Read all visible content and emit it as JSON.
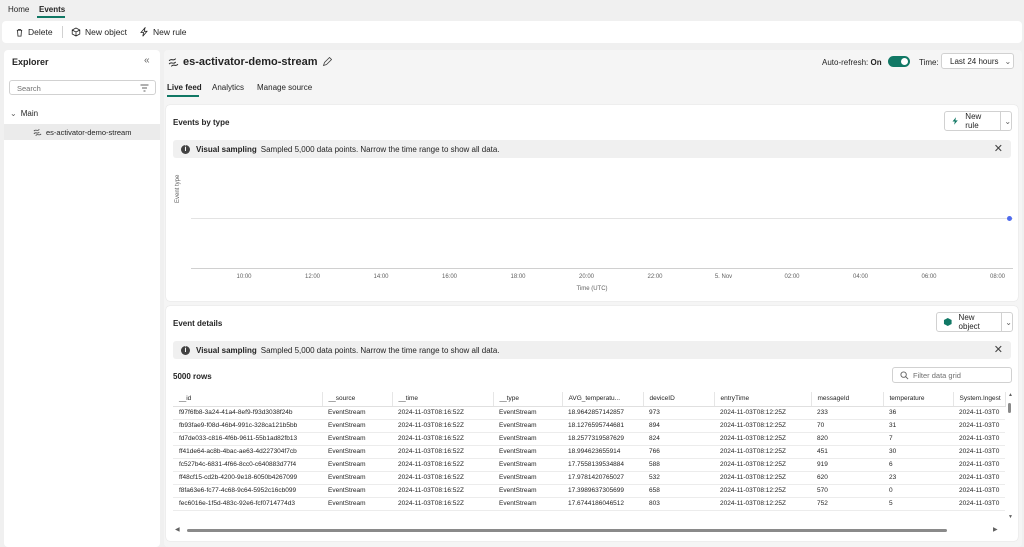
{
  "topnav": {
    "home": "Home",
    "events": "Events"
  },
  "toolbar": {
    "delete": "Delete",
    "new_object": "New object",
    "new_rule": "New rule"
  },
  "explorer": {
    "title": "Explorer",
    "search_placeholder": "Search",
    "group": "Main",
    "item": "es-activator-demo-stream"
  },
  "header": {
    "title": "es-activator-demo-stream",
    "auto_refresh_label": "Auto-refresh:",
    "auto_refresh_value": "On",
    "time_label": "Time:",
    "time_value": "Last 24 hours"
  },
  "tabs": [
    {
      "label": "Live feed"
    },
    {
      "label": "Analytics"
    },
    {
      "label": "Manage source"
    }
  ],
  "events_by_type": {
    "title": "Events by type",
    "new_rule": "New rule",
    "banner_bold": "Visual sampling",
    "banner_text": "Sampled 5,000 data points. Narrow the time range to show all data."
  },
  "chart_data": {
    "type": "scatter",
    "ylabel": "Event type",
    "xlabel": "Time (UTC)",
    "x_ticks": [
      "10:00",
      "12:00",
      "14:00",
      "16:00",
      "18:00",
      "20:00",
      "22:00",
      "5. Nov",
      "02:00",
      "04:00",
      "06:00",
      "08:00"
    ],
    "points": [
      {
        "x": "08:12"
      }
    ]
  },
  "event_details": {
    "title": "Event details",
    "new_object": "New object",
    "banner_bold": "Visual sampling",
    "banner_text": "Sampled 5,000 data points. Narrow the time range to show all data.",
    "row_count": "5000 rows",
    "filter_placeholder": "Filter data grid",
    "columns": [
      "__id",
      "__source",
      "__time",
      "__type",
      "AVG_temperatu...",
      "deviceID",
      "entryTime",
      "messageId",
      "temperature",
      "System.Ingest"
    ],
    "rows": [
      [
        "f97f6fb8-3a24-41a4-8ef9-f93d3038f24b",
        "EventStream",
        "2024-11-03T08:16:52Z",
        "EventStream",
        "18.9642857142857",
        "973",
        "2024-11-03T08:12:25Z",
        "233",
        "36",
        "2024-11-03T0"
      ],
      [
        "fb93fae9-f08d-46b4-991c-328ca121b5bb",
        "EventStream",
        "2024-11-03T08:16:52Z",
        "EventStream",
        "18.1276595744681",
        "894",
        "2024-11-03T08:12:25Z",
        "70",
        "31",
        "2024-11-03T0"
      ],
      [
        "fd7de033-c816-4f6b-9611-55b1ad82fb13",
        "EventStream",
        "2024-11-03T08:16:52Z",
        "EventStream",
        "18.2577319587629",
        "824",
        "2024-11-03T08:12:25Z",
        "820",
        "7",
        "2024-11-03T0"
      ],
      [
        "ff41de64-ac8b-4bac-ae63-4d227304f7cb",
        "EventStream",
        "2024-11-03T08:16:52Z",
        "EventStream",
        "18.994623655914",
        "766",
        "2024-11-03T08:12:25Z",
        "451",
        "30",
        "2024-11-03T0"
      ],
      [
        "fc527b4c-6831-4f66-8cc0-c640883d77f4",
        "EventStream",
        "2024-11-03T08:16:52Z",
        "EventStream",
        "17.7558139534884",
        "588",
        "2024-11-03T08:12:25Z",
        "919",
        "6",
        "2024-11-03T0"
      ],
      [
        "ff48cf15-cd2b-4200-9e18-6050b4267099",
        "EventStream",
        "2024-11-03T08:16:52Z",
        "EventStream",
        "17.9781420765027",
        "532",
        "2024-11-03T08:12:25Z",
        "620",
        "23",
        "2024-11-03T0"
      ],
      [
        "f8fa63e6-fc77-4c68-9c64-5952c16cb099",
        "EventStream",
        "2024-11-03T08:16:52Z",
        "EventStream",
        "17.3989637305699",
        "658",
        "2024-11-03T08:12:25Z",
        "570",
        "0",
        "2024-11-03T0"
      ],
      [
        "fec6016e-1f5d-483c-92e6-fcf0714774d3",
        "EventStream",
        "2024-11-03T08:16:52Z",
        "EventStream",
        "17.6744186046512",
        "803",
        "2024-11-03T08:12:25Z",
        "752",
        "5",
        "2024-11-03T0"
      ]
    ]
  },
  "colors": {
    "accent": "#117865",
    "point": "#4f6bed"
  }
}
